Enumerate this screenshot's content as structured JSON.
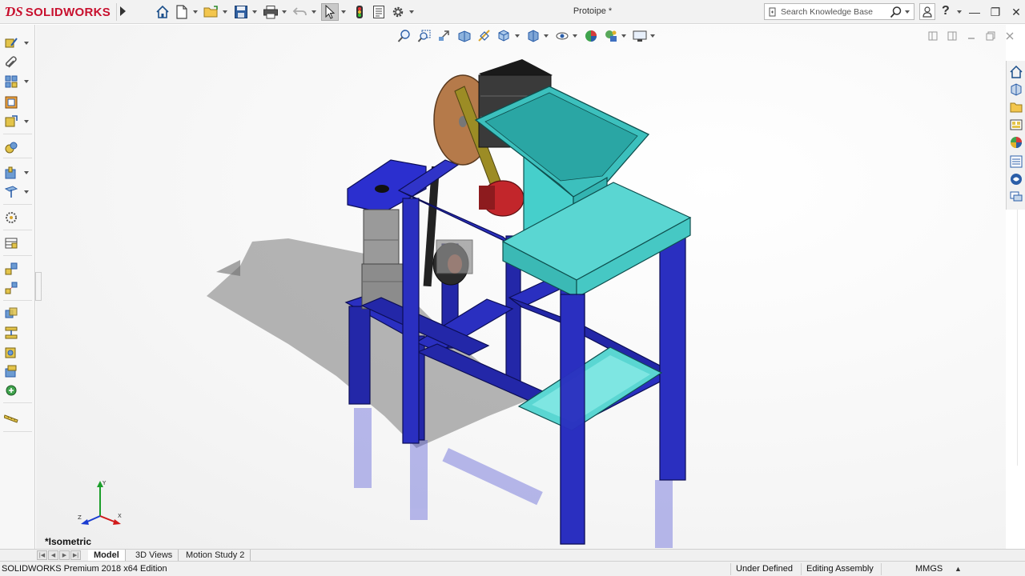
{
  "app": {
    "logo_text": "SOLIDWORKS",
    "document_title": "Protoipe *"
  },
  "search": {
    "placeholder": "Search Knowledge Base"
  },
  "titlebar_buttons": {
    "help": "?",
    "minimize": "—",
    "restore": "❐",
    "close": "✕"
  },
  "quick_access": [
    {
      "name": "home-icon"
    },
    {
      "name": "new-document-icon"
    },
    {
      "name": "open-folder-icon"
    },
    {
      "name": "save-icon"
    },
    {
      "name": "print-icon"
    },
    {
      "name": "undo-icon"
    },
    {
      "name": "select-arrow-icon"
    },
    {
      "name": "traffic-light-icon"
    },
    {
      "name": "file-properties-icon"
    },
    {
      "name": "options-gear-icon"
    }
  ],
  "left_commands": [
    {
      "name": "edit-component-icon"
    },
    {
      "name": "paperclip-icon"
    },
    {
      "name": "linear-pattern-icon"
    },
    {
      "name": "smart-fasteners-icon"
    },
    {
      "name": "move-component-icon"
    },
    {
      "name": "show-hidden-icon"
    },
    {
      "name": "assembly-features-icon"
    },
    {
      "name": "reference-geometry-icon"
    },
    {
      "name": "new-motion-study-icon"
    },
    {
      "name": "bill-of-materials-icon"
    },
    {
      "name": "exploded-view-icon"
    },
    {
      "name": "explode-line-sketch-icon"
    },
    {
      "name": "interference-detection-icon"
    },
    {
      "name": "clearance-verification-icon"
    },
    {
      "name": "hole-alignment-icon"
    },
    {
      "name": "measure-icon"
    },
    {
      "name": "instant3d-icon"
    },
    {
      "name": "ruler-icon"
    }
  ],
  "view_toolbar": [
    {
      "name": "zoom-to-fit-icon"
    },
    {
      "name": "zoom-to-area-icon"
    },
    {
      "name": "previous-view-icon"
    },
    {
      "name": "section-view-icon"
    },
    {
      "name": "dynamic-annotation-icon"
    },
    {
      "name": "view-orientation-icon"
    },
    {
      "name": "display-style-icon"
    },
    {
      "name": "hide-show-items-icon"
    },
    {
      "name": "edit-appearance-icon"
    },
    {
      "name": "apply-scene-icon"
    },
    {
      "name": "view-settings-icon"
    }
  ],
  "task_pane": [
    {
      "name": "solidworks-resources-icon"
    },
    {
      "name": "design-library-icon"
    },
    {
      "name": "file-explorer-icon"
    },
    {
      "name": "view-palette-icon"
    },
    {
      "name": "appearances-scenes-icon"
    },
    {
      "name": "custom-properties-icon"
    },
    {
      "name": "solidworks-forum-icon"
    },
    {
      "name": "chat-icon"
    }
  ],
  "viewport": {
    "view_name": "*Isometric"
  },
  "tabs": {
    "nav": [
      "|◀",
      "◀",
      "▶",
      "▶|"
    ],
    "items": [
      {
        "label": "Model",
        "active": true
      },
      {
        "label": "3D Views",
        "active": false
      },
      {
        "label": "Motion Study 2",
        "active": false
      }
    ]
  },
  "status": {
    "edition": "SOLIDWORKS Premium 2018 x64 Edition",
    "definition": "Under Defined",
    "mode": "Editing Assembly",
    "units": "MMGS",
    "units_caret": "▲"
  },
  "colors": {
    "frame_blue": "#2327a8",
    "hopper_teal": "#3cc0bd",
    "accent_red": "#c8102e",
    "disc_brown": "#b57a4a",
    "motor_red": "#c2262b"
  }
}
